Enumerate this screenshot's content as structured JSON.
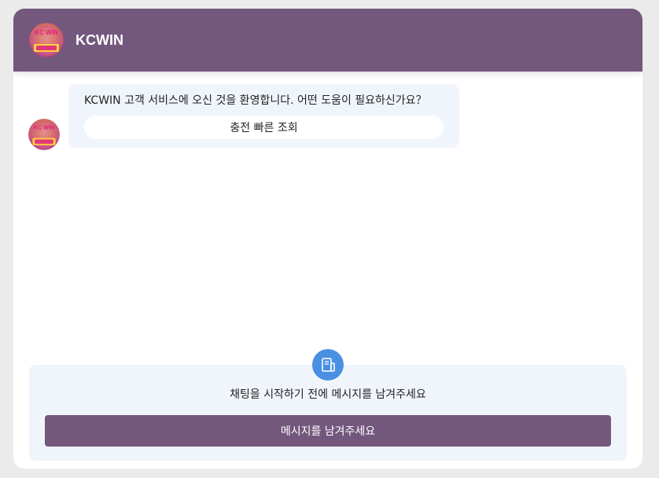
{
  "header": {
    "brand_name": "KCWIN",
    "avatar_icon": "kcwin-logo-icon",
    "avatar_text": "KC WIN"
  },
  "messages": [
    {
      "sender_avatar_icon": "kcwin-logo-icon",
      "text": "KCWIN 고객 서비스에 오신 것을 환영합니다. 어떤 도움이 필요하신가요？",
      "quick_replies": [
        "충전 빠른 조회"
      ]
    }
  ],
  "compose": {
    "icon": "message-form-icon",
    "prompt": "채팅을 시작하기 전에 메시지를 남겨주세요",
    "button_label": "메시지를 남겨주세요"
  },
  "colors": {
    "brand": "#73577d",
    "bubble_bg": "#f0f5fc",
    "icon_accent": "#4a90e2",
    "page_bg": "#ebebeb"
  }
}
